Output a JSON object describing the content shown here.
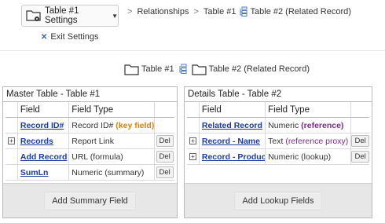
{
  "toolbar": {
    "settings_button_label": "Table #1 Settings",
    "exit_label": "Exit Settings"
  },
  "breadcrumb": {
    "items": [
      "Relationships",
      "Table #1",
      "Table #2 (Related Record)"
    ]
  },
  "relation_header": {
    "master": "Table #1",
    "details": "Table #2 (Related Record)"
  },
  "master_panel": {
    "title": "Master Table - Table #1",
    "columns": [
      "Field",
      "Field Type"
    ],
    "rows": [
      {
        "field": "Record ID#",
        "type": "Record ID#",
        "type_note": "(key field)",
        "expandable": false,
        "deletable": false
      },
      {
        "field": "Records",
        "type": "Report Link",
        "type_note": "",
        "expandable": true,
        "deletable": true
      },
      {
        "field": "Add Record",
        "type": "URL (formula)",
        "type_note": "",
        "expandable": false,
        "deletable": true
      },
      {
        "field": "SumLn",
        "type": "Numeric (summary)",
        "type_note": "",
        "expandable": false,
        "deletable": true
      }
    ],
    "footer_button": "Add Summary Field"
  },
  "details_panel": {
    "title": "Details Table - Table #2",
    "columns": [
      "Field",
      "Field Type"
    ],
    "rows": [
      {
        "field": "Related Record",
        "type": "Numeric",
        "type_note": "(reference)",
        "expandable": false,
        "deletable": false
      },
      {
        "field": "Record - Name",
        "type": "Text",
        "type_note": "(reference proxy)",
        "expandable": true,
        "deletable": true
      },
      {
        "field": "Record - Product",
        "type": "Numeric (lookup)",
        "type_note": "",
        "expandable": true,
        "deletable": true
      }
    ],
    "footer_button": "Add Lookup Fields"
  },
  "labels": {
    "del": "Del",
    "expand": "+"
  },
  "colors": {
    "link": "#1a3aa6",
    "key_field": "#d9830f",
    "reference": "#7a2a8a"
  }
}
